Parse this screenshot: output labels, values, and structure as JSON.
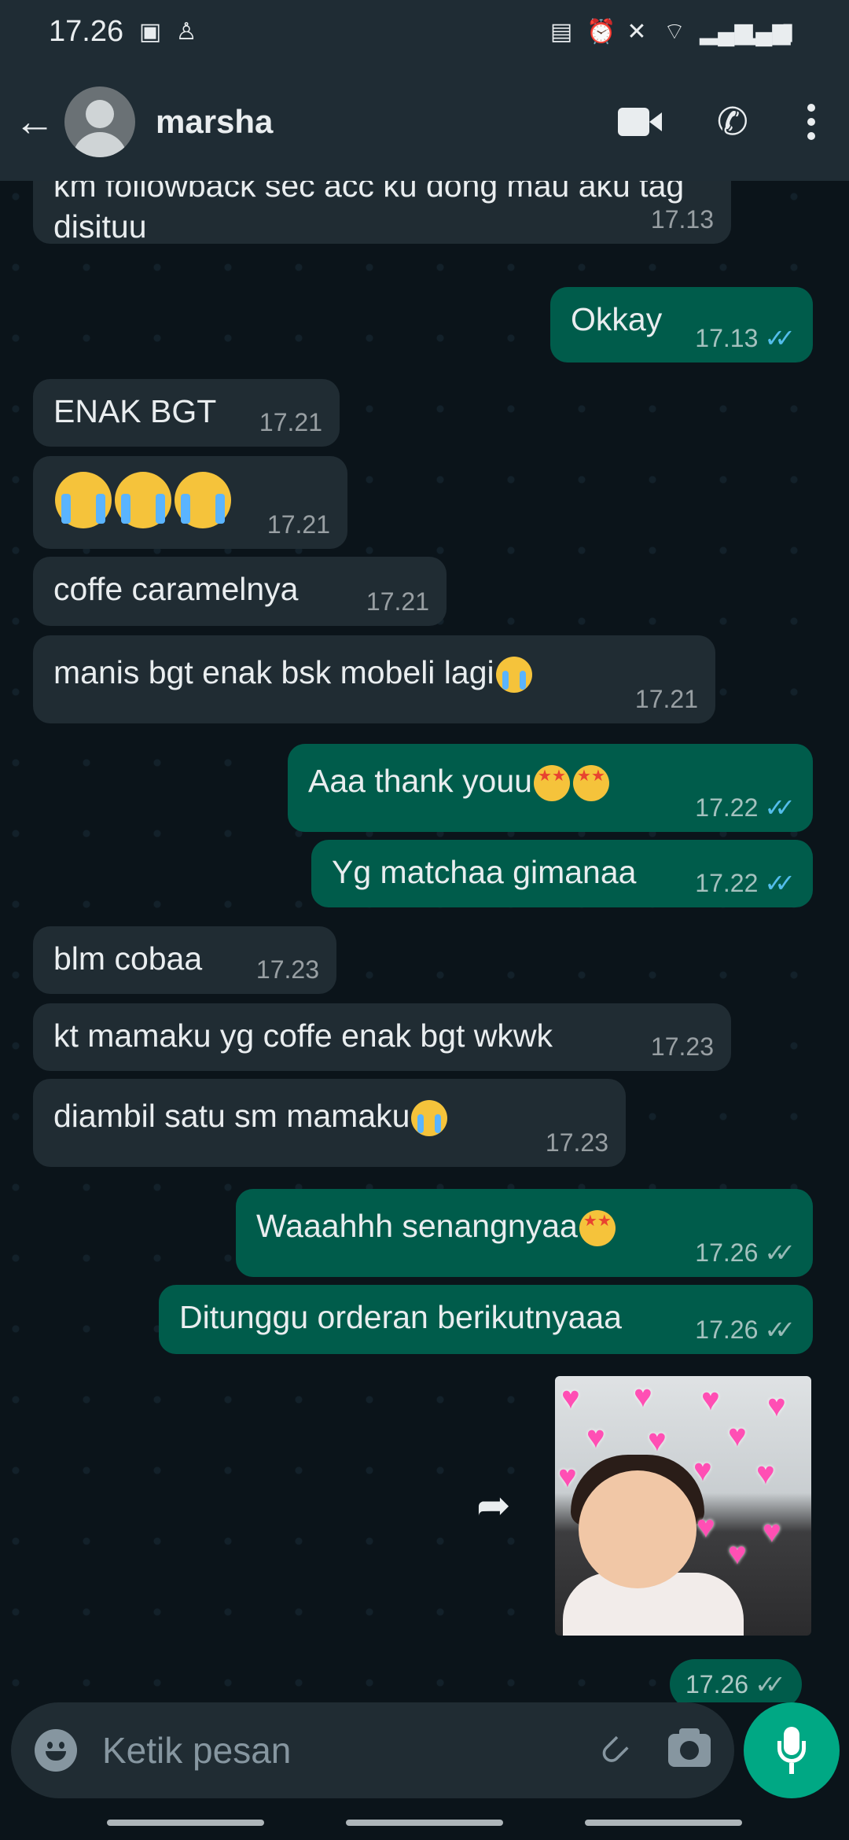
{
  "status_bar": {
    "time": "17.26",
    "left_icons": [
      "image-icon",
      "person-icon"
    ],
    "right_icons": [
      "battery-saver-icon",
      "alarm-icon",
      "mute-icon",
      "wifi-icon",
      "signal-icon",
      "signal-icon",
      "battery-icon"
    ]
  },
  "header": {
    "contact_name": "marsha",
    "icons": [
      "back-arrow-icon",
      "video-call-icon",
      "phone-icon",
      "more-options-icon"
    ]
  },
  "messages": [
    {
      "direction": "in",
      "text": "km followback sec acc ku dong mau aku tag disituu",
      "time": "17.13"
    },
    {
      "direction": "out",
      "text": "Okkay",
      "time": "17.13",
      "status": "read"
    },
    {
      "direction": "in",
      "text": "ENAK BGT",
      "time": "17.21"
    },
    {
      "direction": "in",
      "text": "",
      "emojis": [
        "crying-face",
        "crying-face",
        "crying-face"
      ],
      "time": "17.21"
    },
    {
      "direction": "in",
      "text": "coffe caramelnya",
      "time": "17.21"
    },
    {
      "direction": "in",
      "text": "manis bgt enak bsk mobeli lagi",
      "emojis": [
        "crying-face"
      ],
      "time": "17.21"
    },
    {
      "direction": "out",
      "text": "Aaa thank youu",
      "emojis": [
        "star-struck",
        "star-struck"
      ],
      "time": "17.22",
      "status": "read"
    },
    {
      "direction": "out",
      "text": "Yg matchaa gimanaa",
      "time": "17.22",
      "status": "read"
    },
    {
      "direction": "in",
      "text": "blm cobaa",
      "time": "17.23"
    },
    {
      "direction": "in",
      "text": "kt mamaku yg coffe enak bgt wkwk",
      "time": "17.23"
    },
    {
      "direction": "in",
      "text": "diambil satu sm mamaku",
      "emojis": [
        "crying-face"
      ],
      "time": "17.23"
    },
    {
      "direction": "out",
      "text": "Waaahhh senangnyaa",
      "emojis": [
        "star-struck"
      ],
      "time": "17.26",
      "status": "delivered"
    },
    {
      "direction": "out",
      "text": "Ditunggu orderan berikutnyaaa",
      "time": "17.26",
      "status": "delivered"
    }
  ],
  "sticker": {
    "time": "17.26",
    "status": "delivered"
  },
  "input": {
    "placeholder": "Ketik pesan"
  },
  "colors": {
    "background": "#0b141a",
    "header": "#1f2c34",
    "incoming_bubble": "#202c33",
    "outgoing_bubble": "#005c4b",
    "read_tick": "#53bdeb",
    "mic_button": "#00a884"
  }
}
